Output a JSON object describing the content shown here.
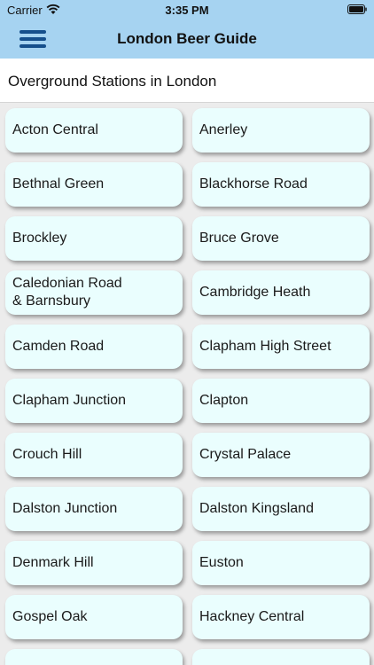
{
  "status_bar": {
    "carrier": "Carrier",
    "time": "3:35 PM"
  },
  "nav": {
    "title": "London Beer Guide",
    "menu_icon": "hamburger-menu-icon"
  },
  "section": {
    "title": "Overground Stations in London"
  },
  "colors": {
    "header_bg": "#a6d3f1",
    "menu_icon": "#154f8c",
    "tile_bg": "#eafefe",
    "page_bg": "#ececec"
  },
  "stations": [
    "Acton Central",
    "Anerley",
    "Bethnal Green",
    "Blackhorse Road",
    "Brockley",
    "Bruce Grove",
    "Caledonian Road\n& Barnsbury",
    "Cambridge Heath",
    "Camden Road",
    "Clapham High Street",
    "Clapham Junction",
    "Clapton",
    "Crouch Hill",
    "Crystal Palace",
    "Dalston Junction",
    "Dalston Kingsland",
    "Denmark Hill",
    "Euston",
    "Gospel Oak",
    "Hackney Central"
  ]
}
